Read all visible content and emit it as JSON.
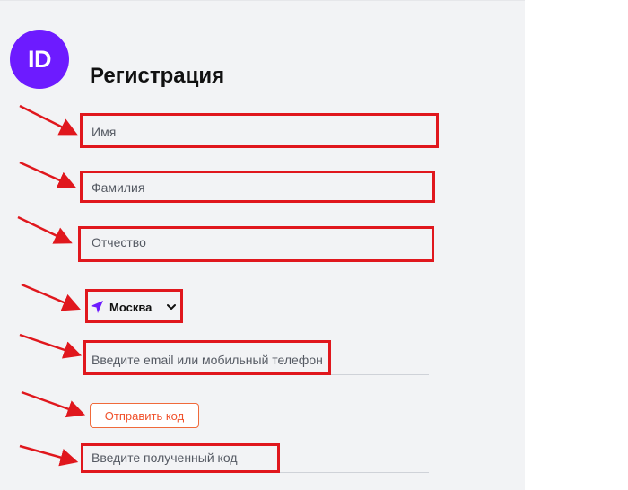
{
  "logo": {
    "text": "ID",
    "color": "#6d1bff"
  },
  "page_title": "Регистрация",
  "fields": {
    "first_name": {
      "placeholder": "Имя"
    },
    "last_name": {
      "placeholder": "Фамилия"
    },
    "middle_name": {
      "placeholder": "Отчество"
    },
    "contact": {
      "placeholder": "Введите email или мобильный телефон"
    },
    "code": {
      "placeholder": "Введите полученный код"
    }
  },
  "city": {
    "value": "Москва",
    "icon": "navigation-arrow-icon"
  },
  "send_code_button": {
    "label": "Отправить код",
    "color": "#f0512b"
  },
  "annotation_color": "#e0171d"
}
